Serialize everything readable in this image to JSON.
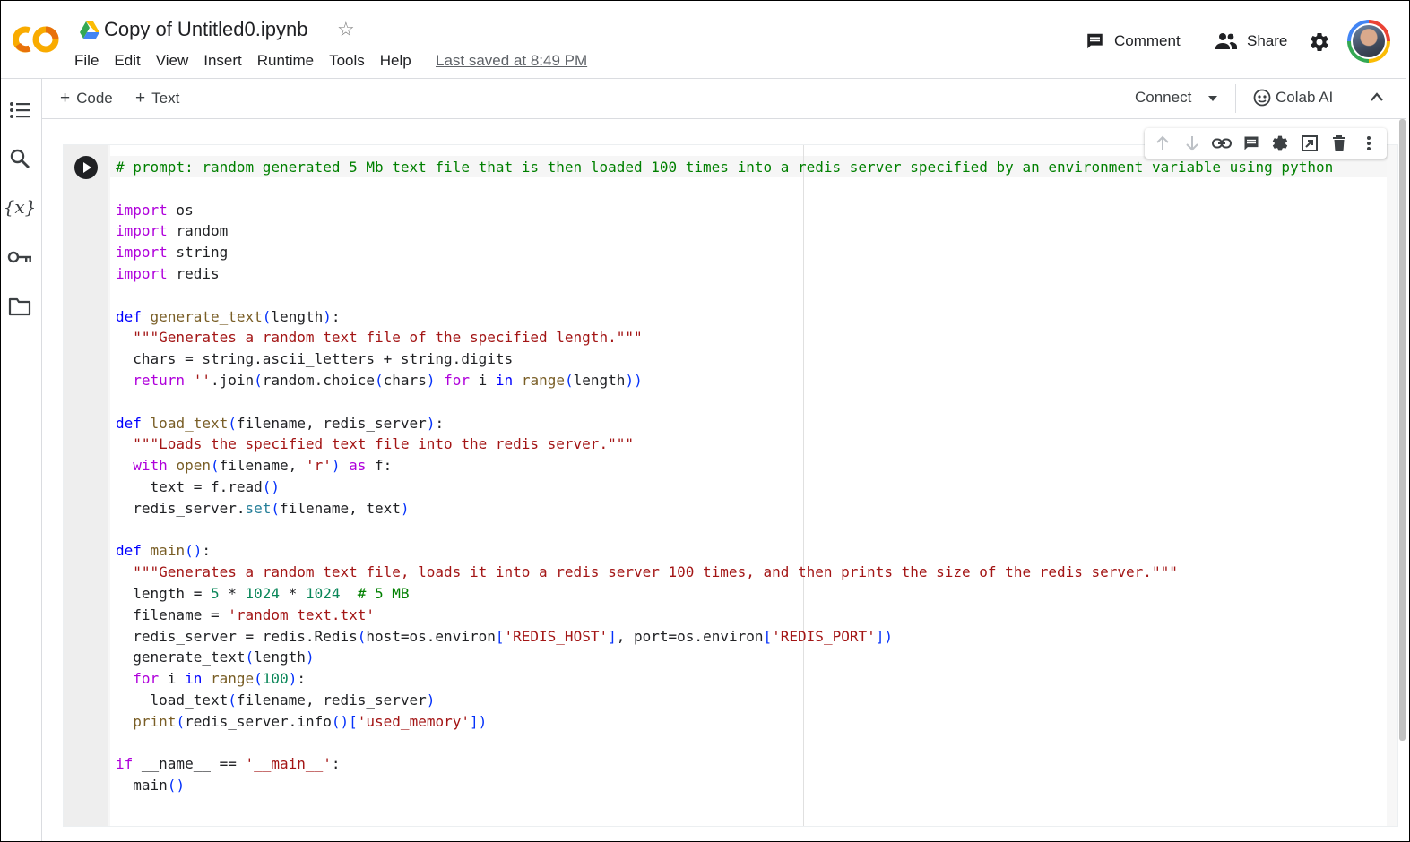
{
  "header": {
    "title": "Copy of Untitled0.ipynb",
    "menu": [
      "File",
      "Edit",
      "View",
      "Insert",
      "Runtime",
      "Tools",
      "Help"
    ],
    "last_saved": "Last saved at 8:49 PM",
    "comment_label": "Comment",
    "share_label": "Share"
  },
  "toolbar": {
    "add_code_label": "Code",
    "add_text_label": "Text",
    "connect_label": "Connect",
    "colab_ai_label": "Colab AI"
  },
  "rail": {
    "icons": [
      "table-of-contents-icon",
      "search-icon",
      "variables-icon",
      "secrets-key-icon",
      "files-folder-icon"
    ]
  },
  "cell": {
    "code_lines": [
      "# prompt: random generated 5 Mb text file that is then loaded 100 times into a redis server specified by an environment variable using python",
      "",
      "import os",
      "import random",
      "import string",
      "import redis",
      "",
      "def generate_text(length):",
      "  \"\"\"Generates a random text file of the specified length.\"\"\"",
      "  chars = string.ascii_letters + string.digits",
      "  return ''.join(random.choice(chars) for i in range(length))",
      "",
      "def load_text(filename, redis_server):",
      "  \"\"\"Loads the specified text file into the redis server.\"\"\"",
      "  with open(filename, 'r') as f:",
      "    text = f.read()",
      "  redis_server.set(filename, text)",
      "",
      "def main():",
      "  \"\"\"Generates a random text file, loads it into a redis server 100 times, and then prints the size of the redis server.\"\"\"",
      "  length = 5 * 1024 * 1024  # 5 MB",
      "  filename = 'random_text.txt'",
      "  redis_server = redis.Redis(host=os.environ['REDIS_HOST'], port=os.environ['REDIS_PORT'])",
      "  generate_text(length)",
      "  for i in range(100):",
      "    load_text(filename, redis_server)",
      "  print(redis_server.info()['used_memory'])",
      "",
      "if __name__ == '__main__':",
      "  main()"
    ]
  },
  "colors": {
    "comment": "#008000",
    "keyword": "#af00db",
    "keyword_blue": "#0000ff",
    "function": "#795e26",
    "string": "#a31515",
    "number": "#098658",
    "logo_orange": "#f9ab00",
    "logo_orange_dark": "#e8710a"
  }
}
